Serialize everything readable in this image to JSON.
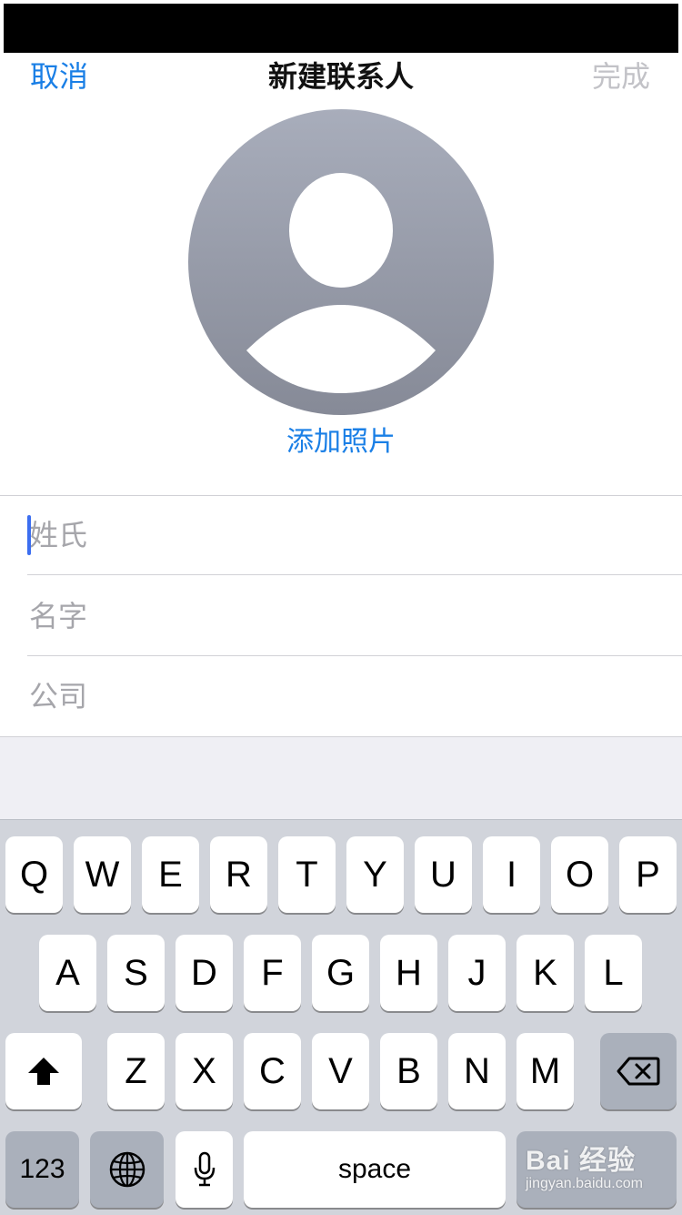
{
  "nav": {
    "cancel_label": "取消",
    "title": "新建联系人",
    "done_label": "完成"
  },
  "avatar": {
    "add_photo_label": "添加照片"
  },
  "fields": [
    {
      "placeholder": "姓氏",
      "value": ""
    },
    {
      "placeholder": "名字",
      "value": ""
    },
    {
      "placeholder": "公司",
      "value": ""
    }
  ],
  "keyboard": {
    "row1": [
      "Q",
      "W",
      "E",
      "R",
      "T",
      "Y",
      "U",
      "I",
      "O",
      "P"
    ],
    "row2": [
      "A",
      "S",
      "D",
      "F",
      "G",
      "H",
      "J",
      "K",
      "L"
    ],
    "row3": [
      "Z",
      "X",
      "C",
      "V",
      "B",
      "N",
      "M"
    ],
    "numbers_label": "123",
    "space_label": "space",
    "icons": {
      "shift": "shift-icon",
      "backspace": "backspace-icon",
      "globe": "globe-icon",
      "mic": "microphone-icon"
    }
  },
  "watermark": {
    "main": "Bai 经验",
    "sub": "jingyan.baidu.com"
  },
  "colors": {
    "accent": "#1a7fe6",
    "disabled": "#c2c2c7",
    "cursor": "#3c6ef0",
    "keyboard_bg": "#d1d4db"
  }
}
